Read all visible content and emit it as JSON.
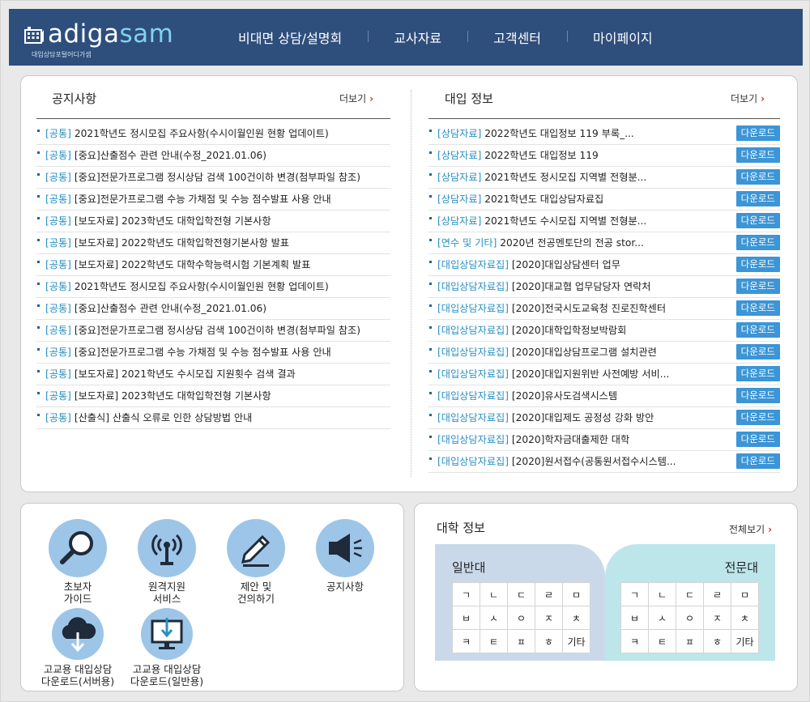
{
  "brand": {
    "logo_text_a": "adiga",
    "logo_text_b": "sam",
    "subtitle": "대입상담포털어디가샘"
  },
  "nav": [
    "비대면 상담/설명회",
    "교사자료",
    "고객센터",
    "마이페이지"
  ],
  "notices": {
    "title": "공지사항",
    "more": "더보기",
    "items": [
      {
        "tag": "[공통]",
        "text": "2021학년도 정시모집 주요사항(수시이월인원 현황 업데이트)"
      },
      {
        "tag": "[공통]",
        "text": "[중요]산출점수 관련 안내(수정_2021.01.06)"
      },
      {
        "tag": "[공통]",
        "text": "[중요]전문가프로그램 정시상담 검색 100건이하 변경(첨부파일 참조)"
      },
      {
        "tag": "[공통]",
        "text": "[중요]전문가프로그램 수능 가채점 및 수능 점수발표 사용 안내"
      },
      {
        "tag": "[공통]",
        "text": "[보도자료] 2023학년도 대학입학전형 기본사항"
      },
      {
        "tag": "[공통]",
        "text": "[보도자료] 2022학년도 대학입학전형기본사항 발표"
      },
      {
        "tag": "[공통]",
        "text": "[보도자료] 2022학년도 대학수학능력시험 기본계획 발표"
      },
      {
        "tag": "[공통]",
        "text": "2021학년도 정시모집 주요사항(수시이월인원 현황 업데이트)"
      },
      {
        "tag": "[공통]",
        "text": "[중요]산출점수 관련 안내(수정_2021.01.06)"
      },
      {
        "tag": "[공통]",
        "text": "[중요]전문가프로그램 정시상담 검색 100건이하 변경(첨부파일 참조)"
      },
      {
        "tag": "[공통]",
        "text": "[중요]전문가프로그램 수능 가채점 및 수능 점수발표 사용 안내"
      },
      {
        "tag": "[공통]",
        "text": "[보도자료] 2021학년도 수시모집 지원횟수 검색 결과"
      },
      {
        "tag": "[공통]",
        "text": "[보도자료] 2023학년도 대학입학전형 기본사항"
      },
      {
        "tag": "[공통]",
        "text": "[산출식] 산출식 오류로 인한 상담방법 안내"
      }
    ]
  },
  "admission": {
    "title": "대입 정보",
    "more": "더보기",
    "download_label": "다운로드",
    "items": [
      {
        "tag": "[상담자료]",
        "text": "2022학년도 대입정보 119 부록_..."
      },
      {
        "tag": "[상담자료]",
        "text": "2022학년도 대입정보 119"
      },
      {
        "tag": "[상담자료]",
        "text": "2021학년도 정시모집 지역별 전형분..."
      },
      {
        "tag": "[상담자료]",
        "text": "2021학년도 대입상담자료집"
      },
      {
        "tag": "[상담자료]",
        "text": "2021학년도 수시모집 지역별 전형분..."
      },
      {
        "tag": "[연수 및 기타]",
        "text": "2020년 전공멘토단의 전공 stor..."
      },
      {
        "tag": "[대입상담자료집]",
        "text": "[2020]대입상담센터 업무"
      },
      {
        "tag": "[대입상담자료집]",
        "text": "[2020]대교협 업무담당자 연락처"
      },
      {
        "tag": "[대입상담자료집]",
        "text": "[2020]전국시도교육청 진로진학센터"
      },
      {
        "tag": "[대입상담자료집]",
        "text": "[2020]대학입학정보박람회"
      },
      {
        "tag": "[대입상담자료집]",
        "text": "[2020]대입상담프로그램 설치관련"
      },
      {
        "tag": "[대입상담자료집]",
        "text": "[2020]대입지원위반 사전예방 서비..."
      },
      {
        "tag": "[대입상담자료집]",
        "text": "[2020]유사도검색시스템"
      },
      {
        "tag": "[대입상담자료집]",
        "text": "[2020]대입제도 공정성 강화 방안"
      },
      {
        "tag": "[대입상담자료집]",
        "text": "[2020]학자금대출제한 대학"
      },
      {
        "tag": "[대입상담자료집]",
        "text": "[2020]원서접수(공통원서접수시스템..."
      }
    ]
  },
  "quicklinks": [
    {
      "label": "초보자\n가이드",
      "icon": "magnifier-icon"
    },
    {
      "label": "원격지원\n서비스",
      "icon": "antenna-icon"
    },
    {
      "label": "제안 및\n건의하기",
      "icon": "pen-icon"
    },
    {
      "label": "공지사항",
      "icon": "megaphone-icon"
    },
    {
      "label": "고교용 대입상담\n다운로드(서버용)",
      "icon": "cloud-download-icon"
    },
    {
      "label": "고교용 대입상담\n다운로드(일반용)",
      "icon": "monitor-download-icon"
    }
  ],
  "university": {
    "title": "대학 정보",
    "more": "전체보기",
    "left_label": "일반대",
    "right_label": "전문대",
    "consonants": [
      [
        "ㄱ",
        "ㄴ",
        "ㄷ",
        "ㄹ",
        "ㅁ"
      ],
      [
        "ㅂ",
        "ㅅ",
        "ㅇ",
        "ㅈ",
        "ㅊ"
      ],
      [
        "ㅋ",
        "ㅌ",
        "ㅍ",
        "ㅎ",
        "기타"
      ]
    ]
  }
}
